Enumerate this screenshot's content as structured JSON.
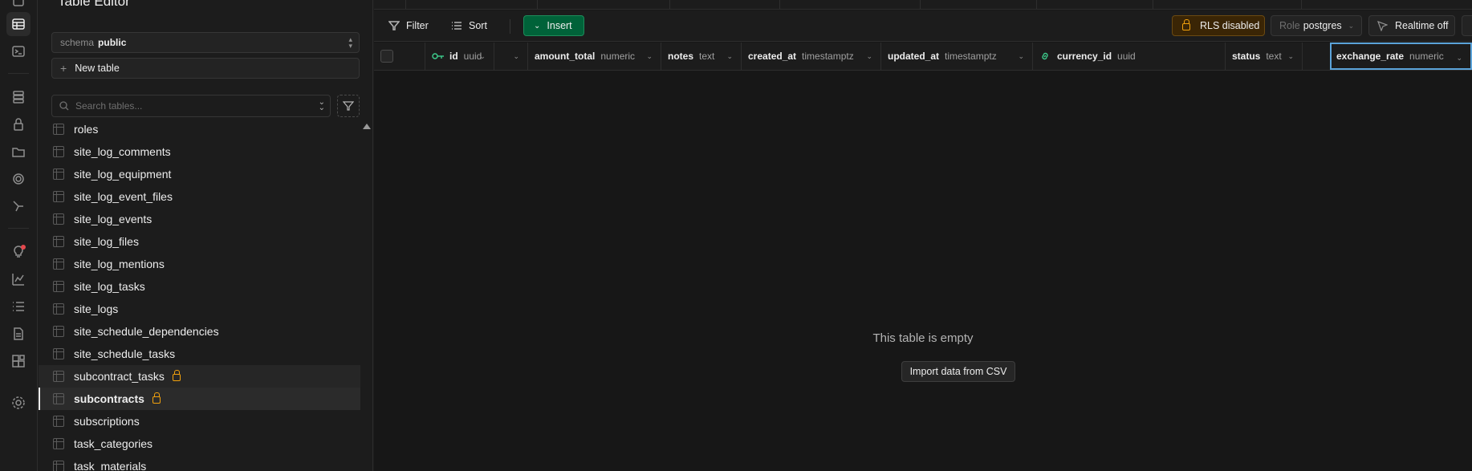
{
  "colors": {
    "background": "#171717",
    "panel": "#1c1c1c",
    "insert_green": "#006239",
    "rls_orange": "#f1a10d",
    "focus_blue": "#5ba3d9",
    "notification_red": "#e5484d"
  },
  "sidebar": {
    "title": "Table Editor",
    "schema": {
      "label": "schema",
      "value": "public"
    },
    "new_table_label": "New table",
    "search_placeholder": "Search tables...",
    "tables": [
      {
        "name": "roles"
      },
      {
        "name": "site_log_comments"
      },
      {
        "name": "site_log_equipment"
      },
      {
        "name": "site_log_event_files"
      },
      {
        "name": "site_log_events"
      },
      {
        "name": "site_log_files"
      },
      {
        "name": "site_log_mentions"
      },
      {
        "name": "site_log_tasks"
      },
      {
        "name": "site_logs"
      },
      {
        "name": "site_schedule_dependencies"
      },
      {
        "name": "site_schedule_tasks"
      },
      {
        "name": "subcontract_tasks",
        "rls_disabled": true
      },
      {
        "name": "subcontracts",
        "rls_disabled": true,
        "selected": true
      },
      {
        "name": "subscriptions"
      },
      {
        "name": "task_categories"
      },
      {
        "name": "task_materials"
      }
    ]
  },
  "toolbar": {
    "filter_label": "Filter",
    "sort_label": "Sort",
    "insert_label": "Insert",
    "rls_label": "RLS disabled",
    "role_label": "Role",
    "role_value": "postgres",
    "realtime_label": "Realtime off"
  },
  "columns": [
    {
      "name": "id",
      "type": "uuid",
      "primary_key": true
    },
    {
      "name": "",
      "type": ""
    },
    {
      "name": "amount_total",
      "type": "numeric"
    },
    {
      "name": "notes",
      "type": "text"
    },
    {
      "name": "created_at",
      "type": "timestamptz"
    },
    {
      "name": "updated_at",
      "type": "timestamptz"
    },
    {
      "name": "currency_id",
      "type": "uuid",
      "foreign_key": true
    },
    {
      "name": "status",
      "type": "text"
    },
    {
      "name": "exchange_rate",
      "type": "numeric",
      "focused": true
    }
  ],
  "empty_state": {
    "message": "This table is empty",
    "import_label": "Import data from CSV"
  }
}
